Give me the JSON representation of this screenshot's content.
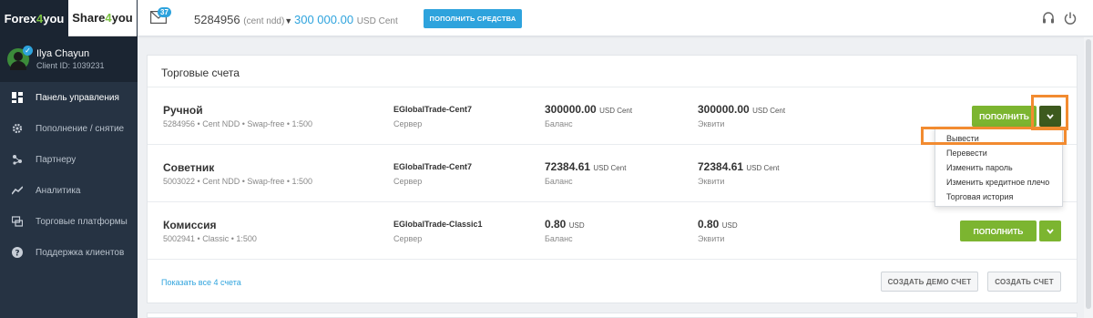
{
  "brand": {
    "forex": {
      "prefix": "Forex",
      "highlight": "4",
      "suffix": "you"
    },
    "share": {
      "prefix": "Share",
      "highlight": "4",
      "suffix": "you"
    }
  },
  "user": {
    "name": "Ilya Chayun",
    "client_id": "Client ID: 1039231"
  },
  "nav": [
    {
      "label": "Панель управления",
      "icon": "dashboard-icon"
    },
    {
      "label": "Пополнение / снятие",
      "icon": "gear-icon"
    },
    {
      "label": "Партнеру",
      "icon": "partner-icon"
    },
    {
      "label": "Аналитика",
      "icon": "chart-line-icon"
    },
    {
      "label": "Торговые платформы",
      "icon": "platform-icon"
    },
    {
      "label": "Поддержка клиентов",
      "icon": "help-icon"
    }
  ],
  "topbar": {
    "mail_count": "37",
    "account_number": "5284956",
    "account_type": "(cent ndd)",
    "balance_value": "300 000.00",
    "balance_currency": "USD Cent",
    "deposit_button": "ПОПОЛНИТЬ СРЕДСТВА"
  },
  "card": {
    "title": "Торговые счета",
    "server_label": "Сервер",
    "balance_label": "Баланс",
    "equity_label": "Эквити",
    "deposit_label": "ПОПОЛНИТЬ",
    "show_all": "Показать все 4 счета",
    "create_demo": "СОЗДАТЬ ДЕМО СЧЕТ",
    "create_account": "СОЗДАТЬ СЧЕТ"
  },
  "accounts": [
    {
      "name": "Ручной",
      "meta": "5284956 • Cent NDD • Swap-free • 1:500",
      "server": "EGlobalTrade-Cent7",
      "balance": "300000.00",
      "balance_currency": "USD Cent",
      "equity": "300000.00",
      "equity_currency": "USD Cent"
    },
    {
      "name": "Советник",
      "meta": "5003022 • Cent NDD • Swap-free • 1:500",
      "server": "EGlobalTrade-Cent7",
      "balance": "72384.61",
      "balance_currency": "USD Cent",
      "equity": "72384.61",
      "equity_currency": "USD Cent"
    },
    {
      "name": "Комиссия",
      "meta": "5002941 • Classic • 1:500",
      "server": "EGlobalTrade-Classic1",
      "balance": "0.80",
      "balance_currency": "USD",
      "equity": "0.80",
      "equity_currency": "USD"
    }
  ],
  "dropdown": [
    "Вывести",
    "Перевести",
    "Изменить пароль",
    "Изменить кредитное плечо",
    "Торговая история"
  ],
  "colors": {
    "accent_blue": "#2ea3dd",
    "green": "#7cb530",
    "dark_green": "#3d5a1e",
    "highlight_orange": "#f28b30",
    "sidebar": "#263343"
  }
}
